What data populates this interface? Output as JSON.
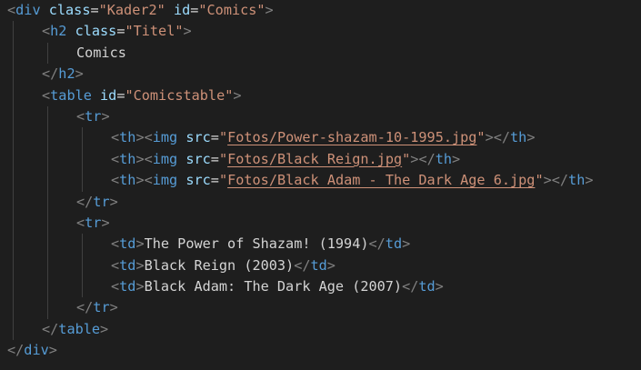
{
  "editor": {
    "theme_colors": {
      "background": "#1e1e1e",
      "tag": "#569cd6",
      "bracket": "#808080",
      "attribute": "#9cdcfe",
      "string": "#ce9178",
      "text": "#d4d4d4",
      "indent_guide": "#404040"
    },
    "lines": [
      {
        "indent": 0,
        "tokens": [
          {
            "t": "bracket",
            "v": "<"
          },
          {
            "t": "tag",
            "v": "div"
          },
          {
            "t": "text",
            "v": " "
          },
          {
            "t": "attr",
            "v": "class"
          },
          {
            "t": "eq",
            "v": "="
          },
          {
            "t": "str",
            "v": "\"Kader2\""
          },
          {
            "t": "text",
            "v": " "
          },
          {
            "t": "attr",
            "v": "id"
          },
          {
            "t": "eq",
            "v": "="
          },
          {
            "t": "str",
            "v": "\"Comics\""
          },
          {
            "t": "bracket",
            "v": ">"
          }
        ]
      },
      {
        "indent": 1,
        "tokens": [
          {
            "t": "bracket",
            "v": "<"
          },
          {
            "t": "tag",
            "v": "h2"
          },
          {
            "t": "text",
            "v": " "
          },
          {
            "t": "attr",
            "v": "class"
          },
          {
            "t": "eq",
            "v": "="
          },
          {
            "t": "str",
            "v": "\"Titel\""
          },
          {
            "t": "bracket",
            "v": ">"
          }
        ]
      },
      {
        "indent": 2,
        "tokens": [
          {
            "t": "text",
            "v": "Comics"
          }
        ]
      },
      {
        "indent": 1,
        "tokens": [
          {
            "t": "bracket",
            "v": "</"
          },
          {
            "t": "tag",
            "v": "h2"
          },
          {
            "t": "bracket",
            "v": ">"
          }
        ]
      },
      {
        "indent": 1,
        "tokens": [
          {
            "t": "bracket",
            "v": "<"
          },
          {
            "t": "tag",
            "v": "table"
          },
          {
            "t": "text",
            "v": " "
          },
          {
            "t": "attr",
            "v": "id"
          },
          {
            "t": "eq",
            "v": "="
          },
          {
            "t": "str",
            "v": "\"Comicstable\""
          },
          {
            "t": "bracket",
            "v": ">"
          }
        ]
      },
      {
        "indent": 2,
        "tokens": [
          {
            "t": "bracket",
            "v": "<"
          },
          {
            "t": "tag",
            "v": "tr"
          },
          {
            "t": "bracket",
            "v": ">"
          }
        ]
      },
      {
        "indent": 3,
        "tokens": [
          {
            "t": "bracket",
            "v": "<"
          },
          {
            "t": "tag",
            "v": "th"
          },
          {
            "t": "bracket",
            "v": ">"
          },
          {
            "t": "bracket",
            "v": "<"
          },
          {
            "t": "tag",
            "v": "img"
          },
          {
            "t": "text",
            "v": " "
          },
          {
            "t": "attr",
            "v": "src"
          },
          {
            "t": "eq",
            "v": "="
          },
          {
            "t": "str",
            "v": "\""
          },
          {
            "t": "link",
            "v": "Fotos/Power-shazam-10-1995.jpg"
          },
          {
            "t": "str",
            "v": "\""
          },
          {
            "t": "bracket",
            "v": ">"
          },
          {
            "t": "bracket",
            "v": "</"
          },
          {
            "t": "tag",
            "v": "th"
          },
          {
            "t": "bracket",
            "v": ">"
          }
        ]
      },
      {
        "indent": 3,
        "tokens": [
          {
            "t": "bracket",
            "v": "<"
          },
          {
            "t": "tag",
            "v": "th"
          },
          {
            "t": "bracket",
            "v": ">"
          },
          {
            "t": "bracket",
            "v": "<"
          },
          {
            "t": "tag",
            "v": "img"
          },
          {
            "t": "text",
            "v": " "
          },
          {
            "t": "attr",
            "v": "src"
          },
          {
            "t": "eq",
            "v": "="
          },
          {
            "t": "str",
            "v": "\""
          },
          {
            "t": "link",
            "v": "Fotos/Black Reign.jpg"
          },
          {
            "t": "str",
            "v": "\""
          },
          {
            "t": "bracket",
            "v": ">"
          },
          {
            "t": "bracket",
            "v": "</"
          },
          {
            "t": "tag",
            "v": "th"
          },
          {
            "t": "bracket",
            "v": ">"
          }
        ]
      },
      {
        "indent": 3,
        "tokens": [
          {
            "t": "bracket",
            "v": "<"
          },
          {
            "t": "tag",
            "v": "th"
          },
          {
            "t": "bracket",
            "v": ">"
          },
          {
            "t": "bracket",
            "v": "<"
          },
          {
            "t": "tag",
            "v": "img"
          },
          {
            "t": "text",
            "v": " "
          },
          {
            "t": "attr",
            "v": "src"
          },
          {
            "t": "eq",
            "v": "="
          },
          {
            "t": "str",
            "v": "\""
          },
          {
            "t": "link",
            "v": "Fotos/Black_Adam_-_The_Dark_Age_6.jpg"
          },
          {
            "t": "str",
            "v": "\""
          },
          {
            "t": "bracket",
            "v": ">"
          },
          {
            "t": "bracket",
            "v": "</"
          },
          {
            "t": "tag",
            "v": "th"
          },
          {
            "t": "bracket",
            "v": ">"
          }
        ]
      },
      {
        "indent": 2,
        "tokens": [
          {
            "t": "bracket",
            "v": "</"
          },
          {
            "t": "tag",
            "v": "tr"
          },
          {
            "t": "bracket",
            "v": ">"
          }
        ]
      },
      {
        "indent": 2,
        "tokens": [
          {
            "t": "bracket",
            "v": "<"
          },
          {
            "t": "tag",
            "v": "tr"
          },
          {
            "t": "bracket",
            "v": ">"
          }
        ]
      },
      {
        "indent": 3,
        "tokens": [
          {
            "t": "bracket",
            "v": "<"
          },
          {
            "t": "tag",
            "v": "td"
          },
          {
            "t": "bracket",
            "v": ">"
          },
          {
            "t": "text",
            "v": "The Power of Shazam! (1994)"
          },
          {
            "t": "bracket",
            "v": "</"
          },
          {
            "t": "tag",
            "v": "td"
          },
          {
            "t": "bracket",
            "v": ">"
          }
        ]
      },
      {
        "indent": 3,
        "tokens": [
          {
            "t": "bracket",
            "v": "<"
          },
          {
            "t": "tag",
            "v": "td"
          },
          {
            "t": "bracket",
            "v": ">"
          },
          {
            "t": "text",
            "v": "Black Reign (2003)"
          },
          {
            "t": "bracket",
            "v": "</"
          },
          {
            "t": "tag",
            "v": "td"
          },
          {
            "t": "bracket",
            "v": ">"
          }
        ]
      },
      {
        "indent": 3,
        "tokens": [
          {
            "t": "bracket",
            "v": "<"
          },
          {
            "t": "tag",
            "v": "td"
          },
          {
            "t": "bracket",
            "v": ">"
          },
          {
            "t": "text",
            "v": "Black Adam: The Dark Age (2007)"
          },
          {
            "t": "bracket",
            "v": "</"
          },
          {
            "t": "tag",
            "v": "td"
          },
          {
            "t": "bracket",
            "v": ">"
          }
        ]
      },
      {
        "indent": 2,
        "tokens": [
          {
            "t": "bracket",
            "v": "</"
          },
          {
            "t": "tag",
            "v": "tr"
          },
          {
            "t": "bracket",
            "v": ">"
          }
        ]
      },
      {
        "indent": 1,
        "tokens": [
          {
            "t": "bracket",
            "v": "</"
          },
          {
            "t": "tag",
            "v": "table"
          },
          {
            "t": "bracket",
            "v": ">"
          }
        ]
      },
      {
        "indent": 0,
        "tokens": [
          {
            "t": "bracket",
            "v": "</"
          },
          {
            "t": "tag",
            "v": "div"
          },
          {
            "t": "bracket",
            "v": ">"
          }
        ]
      }
    ]
  }
}
